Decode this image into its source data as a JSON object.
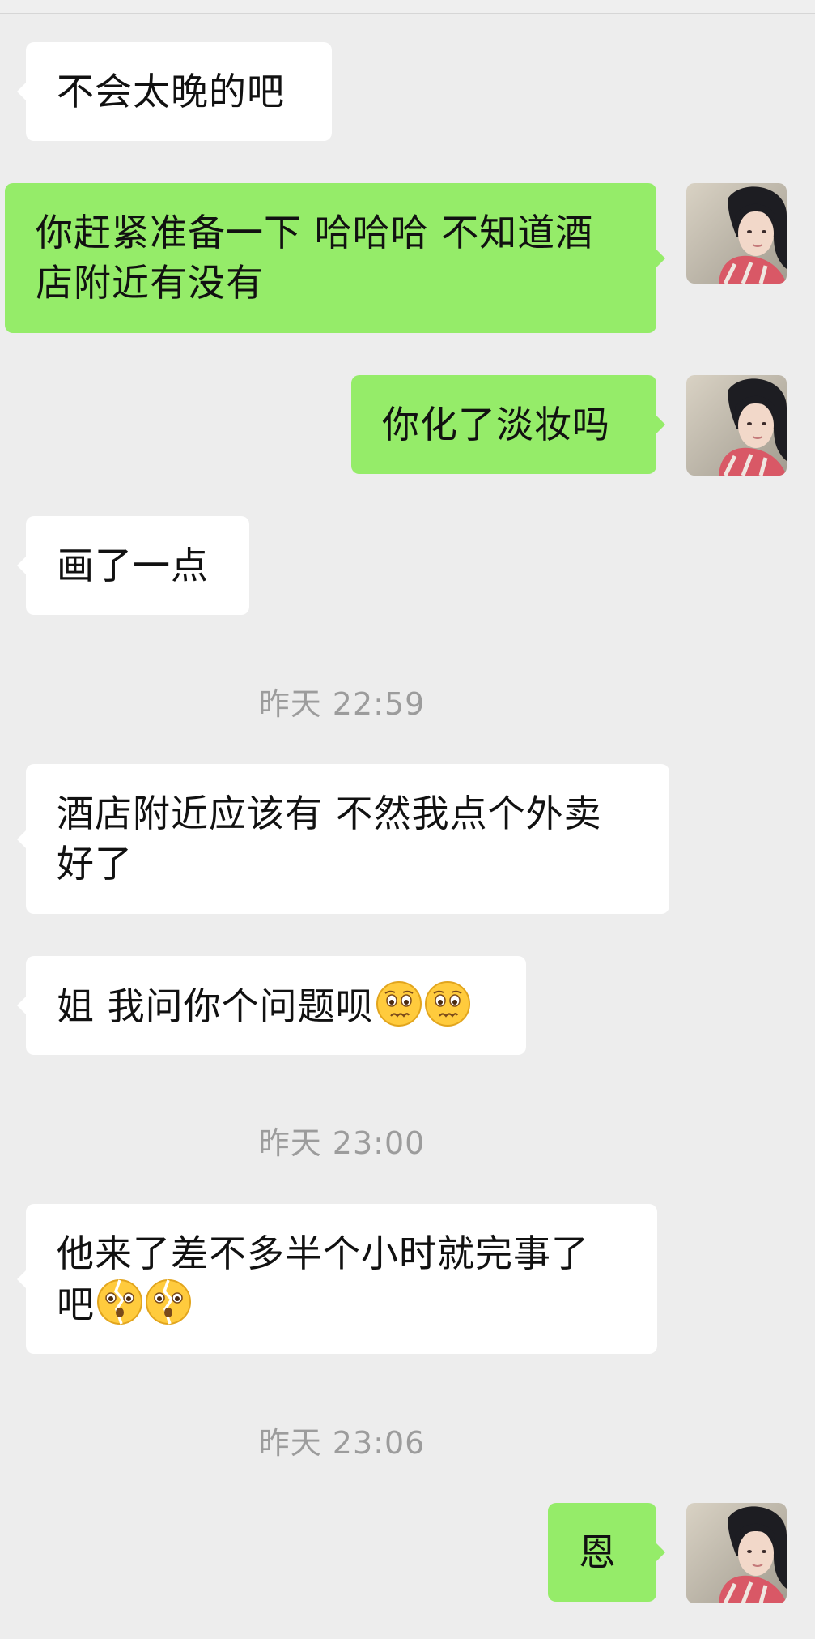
{
  "messages": {
    "m1": {
      "text": "不会太晚的吧"
    },
    "m2": {
      "line1": "你赶紧准备一下 哈哈哈 不知道酒",
      "line2": "店附近有没有"
    },
    "m3": {
      "text": "你化了淡妆吗"
    },
    "m4": {
      "text": "画了一点"
    },
    "t1": {
      "text": "昨天 22:59"
    },
    "m5": {
      "line1": "酒店附近应该有 不然我点个外卖",
      "line2": "好了"
    },
    "m6": {
      "text": "姐 我问你个问题呗",
      "emoji": "worried-face-emoji"
    },
    "t2": {
      "text": "昨天 23:00"
    },
    "m7": {
      "line1": "他来了差不多半个小时就完事了",
      "line2": "吧",
      "emoji": "broken-face-emoji"
    },
    "t3": {
      "text": "昨天 23:06"
    },
    "m8": {
      "text": "恩"
    }
  },
  "colors": {
    "background": "#ededed",
    "incoming_bubble": "#ffffff",
    "outgoing_bubble": "#95ec69",
    "timestamp_text": "#9c9c9c"
  }
}
